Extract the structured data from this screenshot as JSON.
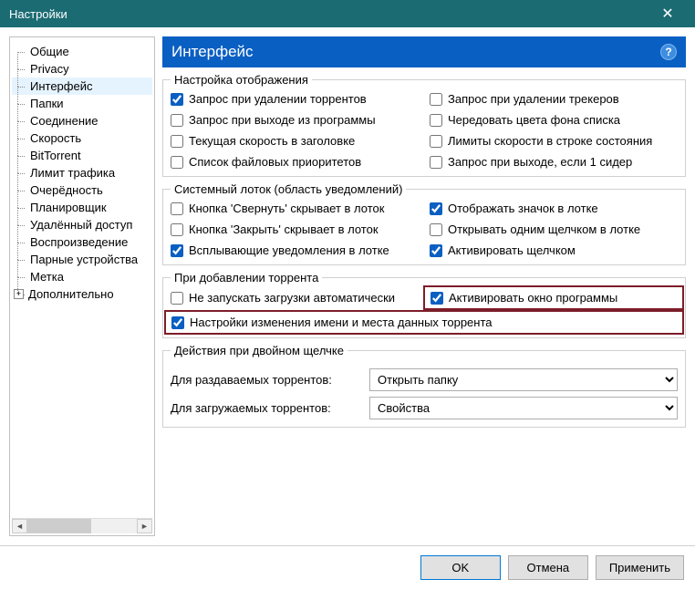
{
  "window": {
    "title": "Настройки",
    "close": "✕"
  },
  "tree": {
    "items": [
      "Общие",
      "Privacy",
      "Интерфейс",
      "Папки",
      "Соединение",
      "Скорость",
      "BitTorrent",
      "Лимит трафика",
      "Очерёдность",
      "Планировщик",
      "Удалённый доступ",
      "Воспроизведение",
      "Парные устройства",
      "Метка"
    ],
    "expandable": "Дополнительно",
    "expand_glyph": "+",
    "selected_index": 2
  },
  "header": {
    "title": "Интерфейс",
    "help": "?"
  },
  "group_display": {
    "legend": "Настройка отображения",
    "items": [
      {
        "label": "Запрос при удалении торрентов",
        "checked": true
      },
      {
        "label": "Запрос при удалении трекеров",
        "checked": false
      },
      {
        "label": "Запрос при выходе из программы",
        "checked": false
      },
      {
        "label": "Чередовать цвета фона списка",
        "checked": false
      },
      {
        "label": "Текущая скорость в заголовке",
        "checked": false
      },
      {
        "label": "Лимиты скорости в строке состояния",
        "checked": false
      },
      {
        "label": "Список файловых приоритетов",
        "checked": false
      },
      {
        "label": "Запрос при выходе, если 1 сидер",
        "checked": false
      }
    ]
  },
  "group_tray": {
    "legend": "Системный лоток (область уведомлений)",
    "items": [
      {
        "label": "Кнопка 'Свернуть' скрывает в лоток",
        "checked": false
      },
      {
        "label": "Отображать значок в лотке",
        "checked": true
      },
      {
        "label": "Кнопка 'Закрыть' скрывает в лоток",
        "checked": false
      },
      {
        "label": "Открывать одним щелчком в лотке",
        "checked": false
      },
      {
        "label": "Всплывающие уведомления в лотке",
        "checked": true
      },
      {
        "label": "Активировать щелчком",
        "checked": true
      }
    ]
  },
  "group_adding": {
    "legend": "При добавлении торрента",
    "items": [
      {
        "label": "Не запускать загрузки автоматически",
        "checked": false
      },
      {
        "label": "Активировать окно программы",
        "checked": true
      },
      {
        "label": "Настройки изменения имени и места данных торрента",
        "checked": true
      }
    ]
  },
  "group_dclick": {
    "legend": "Действия при двойном щелчке",
    "seeding_label": "Для раздаваемых торрентов:",
    "seeding_value": "Открыть папку",
    "downloading_label": "Для загружаемых торрентов:",
    "downloading_value": "Свойства"
  },
  "buttons": {
    "ok": "OK",
    "cancel": "Отмена",
    "apply": "Применить"
  }
}
